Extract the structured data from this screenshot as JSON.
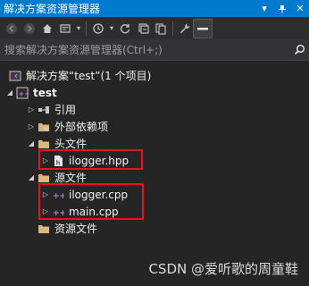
{
  "window": {
    "title": "解决方案资源管理器",
    "pin_icon": "pin-icon",
    "close_icon": "close-icon"
  },
  "search": {
    "placeholder": "搜索解决方案资源管理器(Ctrl+;)",
    "icon": "search-icon"
  },
  "tree": {
    "solution": "解决方案“test”(1 个项目)",
    "project": "test",
    "references": "引用",
    "external_deps": "外部依赖项",
    "header_filter": "头文件",
    "header_file": "ilogger.hpp",
    "source_filter": "源文件",
    "source_files": [
      "ilogger.cpp",
      "main.cpp"
    ],
    "resource_filter": "资源文件"
  },
  "colors": {
    "accent": "#007acc",
    "background": "#252526",
    "highlight_border": "#e81123",
    "folder": "#dcb67a",
    "cpp_icon": "#9b4f96"
  },
  "watermark": "CSDN @爱听歌的周童鞋"
}
